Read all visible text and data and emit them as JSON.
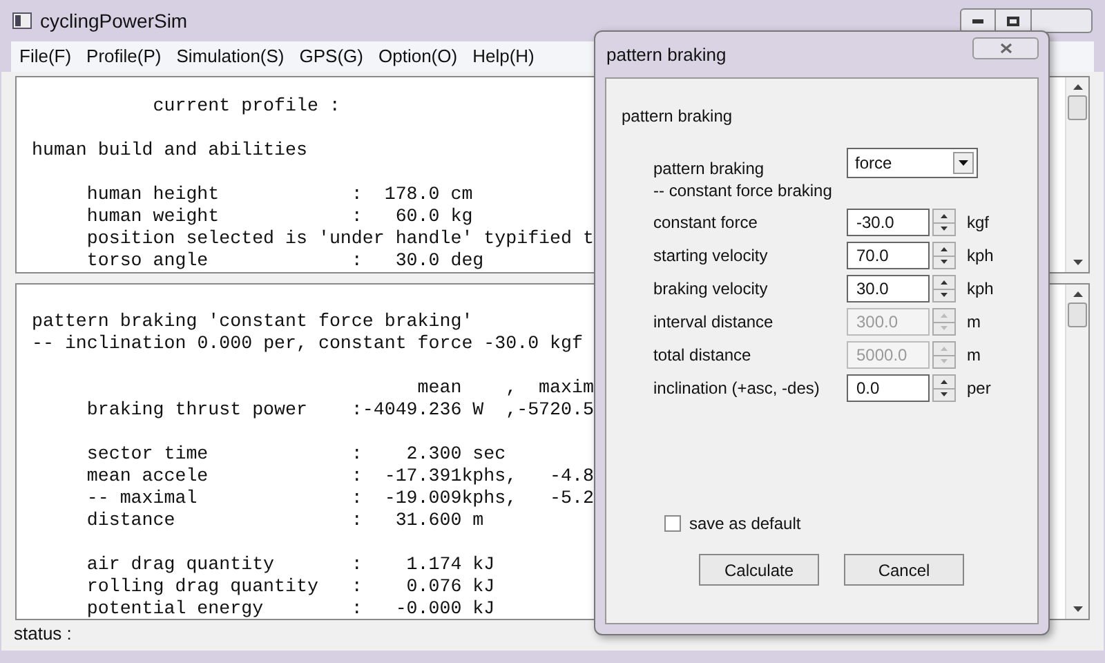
{
  "window": {
    "title": "cyclingPowerSim"
  },
  "menu": [
    "File(F)",
    "Profile(P)",
    "Simulation(S)",
    "GPS(G)",
    "Option(O)",
    "Help(H)"
  ],
  "profile_pane": {
    "lines": [
      {
        "kind": "title",
        "text": "current profile :"
      },
      {
        "kind": "blank"
      },
      {
        "kind": "plain",
        "text": "human build and abilities"
      },
      {
        "kind": "blank"
      },
      {
        "kind": "indent",
        "text": "human height            :  178.0 cm"
      },
      {
        "kind": "indent",
        "text": "human weight            :   60.0 kg"
      },
      {
        "kind": "indent",
        "text": "position selected is 'under handle' typified t"
      },
      {
        "kind": "indent",
        "text": "torso angle             :   30.0 deg"
      }
    ]
  },
  "result_pane": {
    "lines": [
      {
        "kind": "plain",
        "text": "pattern braking 'constant force braking'"
      },
      {
        "kind": "plain",
        "text": "-- inclination 0.000 per, constant force -30.0 kgf"
      },
      {
        "kind": "blank"
      },
      {
        "kind": "column_header",
        "text": "mean    ,  maxim"
      },
      {
        "kind": "indent",
        "text": "braking thrust power    :-4049.236 W  ,-5720.5"
      },
      {
        "kind": "blank"
      },
      {
        "kind": "indent",
        "text": "sector time             :    2.300 sec"
      },
      {
        "kind": "indent",
        "text": "mean accele             :  -17.391kphs,   -4.8"
      },
      {
        "kind": "indent",
        "text": "-- maximal              :  -19.009kphs,   -5.2"
      },
      {
        "kind": "indent",
        "text": "distance                :   31.600 m"
      },
      {
        "kind": "blank"
      },
      {
        "kind": "indent",
        "text": "air drag quantity       :    1.174 kJ"
      },
      {
        "kind": "indent",
        "text": "rolling drag quantity   :    0.076 kJ"
      },
      {
        "kind": "indent",
        "text": "potential energy        :   -0.000 kJ"
      }
    ]
  },
  "status_bar": "status :",
  "dialog": {
    "title": "pattern braking",
    "group_label": "pattern braking",
    "pattern": {
      "label": "pattern braking",
      "value": "force",
      "note": "-- constant force braking"
    },
    "fields": [
      {
        "label": "constant force",
        "value": "-30.0",
        "unit": "kgf",
        "disabled": false
      },
      {
        "label": "starting velocity",
        "value": "70.0",
        "unit": "kph",
        "disabled": false
      },
      {
        "label": "braking velocity",
        "value": "30.0",
        "unit": "kph",
        "disabled": false
      },
      {
        "label": "interval distance",
        "value": "300.0",
        "unit": "m",
        "disabled": true
      },
      {
        "label": "total distance",
        "value": "5000.0",
        "unit": "m",
        "disabled": true
      },
      {
        "label": "inclination (+asc, -des)",
        "value": "0.0",
        "unit": "per",
        "disabled": false
      }
    ],
    "save_default": {
      "label": "save as default",
      "checked": false
    },
    "buttons": [
      "Calculate",
      "Cancel"
    ]
  }
}
